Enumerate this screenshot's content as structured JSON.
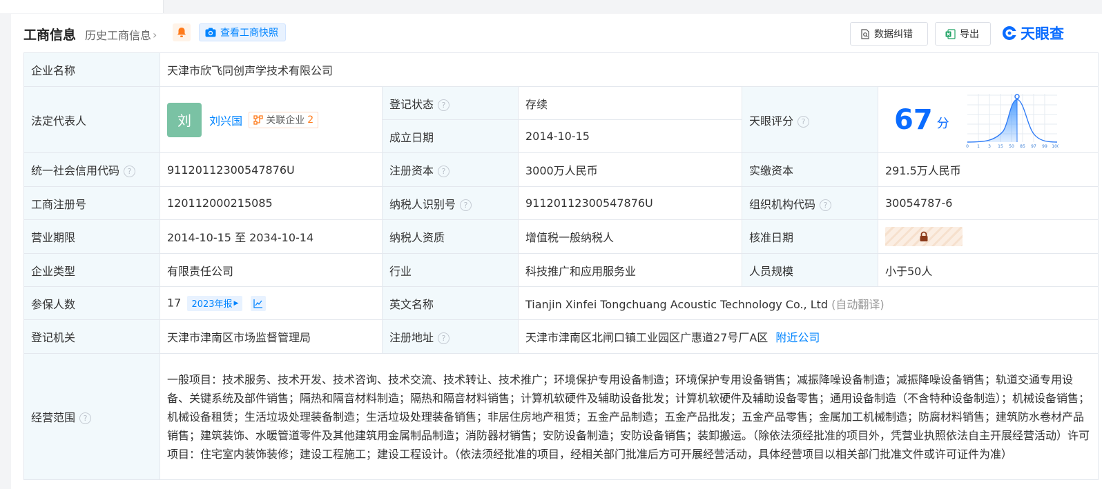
{
  "header": {
    "title": "工商信息",
    "history_link": "历史工商信息",
    "snapshot_button": "查看工商快照",
    "data_error_button": "数据纠错",
    "export_button": "导出",
    "logo_text": "天眼查"
  },
  "company": {
    "name_label": "企业名称",
    "name": "天津市欣飞同创声学技术有限公司",
    "legal_rep_label": "法定代表人",
    "legal_rep_avatar": "刘",
    "legal_rep_name": "刘兴国",
    "related_label": "关联企业",
    "related_count": "2",
    "status_label": "登记状态",
    "status": "存续",
    "founded_label": "成立日期",
    "founded": "2014-10-15",
    "score_label": "天眼评分",
    "score": "67",
    "score_unit": "分",
    "score_ticks": [
      "0",
      "1",
      "3",
      "15",
      "50",
      "85",
      "97",
      "99",
      "100"
    ],
    "credit_code_label": "统一社会信用代码",
    "credit_code": "91120112300547876U",
    "reg_capital_label": "注册资本",
    "reg_capital": "3000万人民币",
    "paid_capital_label": "实缴资本",
    "paid_capital": "291.5万人民币",
    "reg_no_label": "工商注册号",
    "reg_no": "120112000215085",
    "taxpayer_id_label": "纳税人识别号",
    "taxpayer_id": "91120112300547876U",
    "org_code_label": "组织机构代码",
    "org_code": "30054787-6",
    "term_label": "营业期限",
    "term": "2014-10-15 至 2034-10-14",
    "taxpayer_qual_label": "纳税人资质",
    "taxpayer_qual": "增值税一般纳税人",
    "approval_date_label": "核准日期",
    "type_label": "企业类型",
    "type": "有限责任公司",
    "industry_label": "行业",
    "industry": "科技推广和应用服务业",
    "staff_label": "人员规模",
    "staff": "小于50人",
    "insured_label": "参保人数",
    "insured": "17",
    "insured_year": "2023年报",
    "english_name_label": "英文名称",
    "english_name": "Tianjin Xinfei Tongchuang Acoustic Technology Co., Ltd",
    "auto_translate": "(自动翻译)",
    "authority_label": "登记机关",
    "authority": "天津市津南区市场监督管理局",
    "address_label": "注册地址",
    "address": "天津市津南区北闸口镇工业园区广惠道27号厂A区",
    "nearby_link": "附近公司",
    "scope_label": "经营范围",
    "scope": "一般项目：技术服务、技术开发、技术咨询、技术交流、技术转让、技术推广；环境保护专用设备制造；环境保护专用设备销售；减振降噪设备制造；减振降噪设备销售；轨道交通专用设备、关键系统及部件销售；隔热和隔音材料制造；隔热和隔音材料销售；计算机软硬件及辅助设备批发；计算机软硬件及辅助设备零售；通用设备制造（不含特种设备制造）；机械设备销售；机械设备租赁；生活垃圾处理装备制造；生活垃圾处理装备销售；非居住房地产租赁；五金产品制造；五金产品批发；五金产品零售；金属加工机械制造；防腐材料销售；建筑防水卷材产品销售；建筑装饰、水暖管道零件及其他建筑用金属制品制造；消防器材销售；安防设备制造；安防设备销售；装卸搬运。（除依法须经批准的项目外，凭营业执照依法自主开展经营活动）许可项目：住宅室内装饰装修；建设工程施工；建设工程设计。（依法须经批准的项目，经相关部门批准后方可开展经营活动，具体经营项目以相关部门批准文件或许可证件为准）"
  },
  "colors": {
    "accent": "#0084ff",
    "label_bg": "#f2f9fc",
    "status_green": "#00a854",
    "avatar_green": "#7ac2a4",
    "orange": "#ff7a1a"
  },
  "icons": {
    "bell": "bell-icon",
    "camera": "camera-icon",
    "data_error": "document-search-icon",
    "export": "excel-icon",
    "related": "network-icon",
    "trend": "trend-chart-icon",
    "lock": "lock-icon",
    "help": "question-icon"
  }
}
